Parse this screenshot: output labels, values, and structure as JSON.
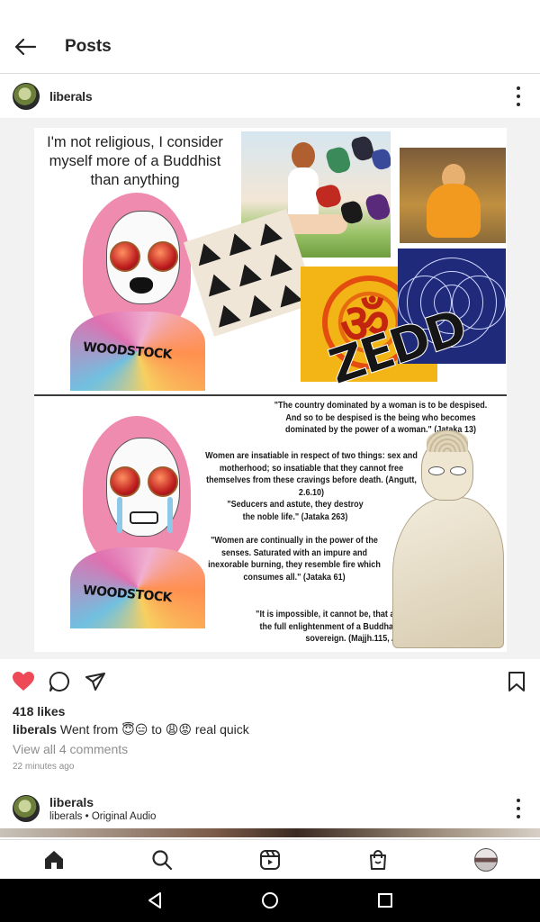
{
  "header": {
    "title": "Posts"
  },
  "post": {
    "username": "liberals",
    "meme": {
      "speech": "I'm not religious, I consider myself more of a Buddhist than anything",
      "shirt_text": "WOODSTOCK",
      "zedd_text": "ZEDD",
      "om_symbol": "ॐ",
      "quotes": [
        "\"The country dominated by a woman is to be despised. And so to be despised is the being who becomes dominated by the power of a woman.\" (Jataka 13)",
        "Women are insatiable in respect of two things: sex and motherhood; so insatiable that they cannot free themselves from these cravings before death. (Angutt, 2.6.10)",
        "\"Seducers and astute, they destroy the noble life.\" (Jataka 263)",
        "\"Women are continually in the power of the senses. Saturated with an impure and inexorable burning, they resemble fire which consumes all.\" (Jataka 61)",
        "\"It is impossible, it cannot be, that a woman should arrive at the full enlightenment of a Buddha, or become a universal sovereign. (Majjh.115, Angut. 1.20)"
      ]
    },
    "likes": "418 likes",
    "caption_user": "liberals",
    "caption_text": "Went from 😇😑 to 😩😡 real quick",
    "view_comments": "View all 4 comments",
    "time": "22 minutes ago"
  },
  "next_post": {
    "username": "liberals",
    "audio": "liberals • Original Audio"
  },
  "icons": {
    "back": "back-arrow-icon",
    "more": "more-vertical-icon",
    "like": "heart-icon",
    "comment": "comment-icon",
    "share": "share-icon",
    "save": "bookmark-icon"
  },
  "colors": {
    "like": "#ed4956",
    "text": "#262626",
    "muted": "#8e8e8e"
  }
}
